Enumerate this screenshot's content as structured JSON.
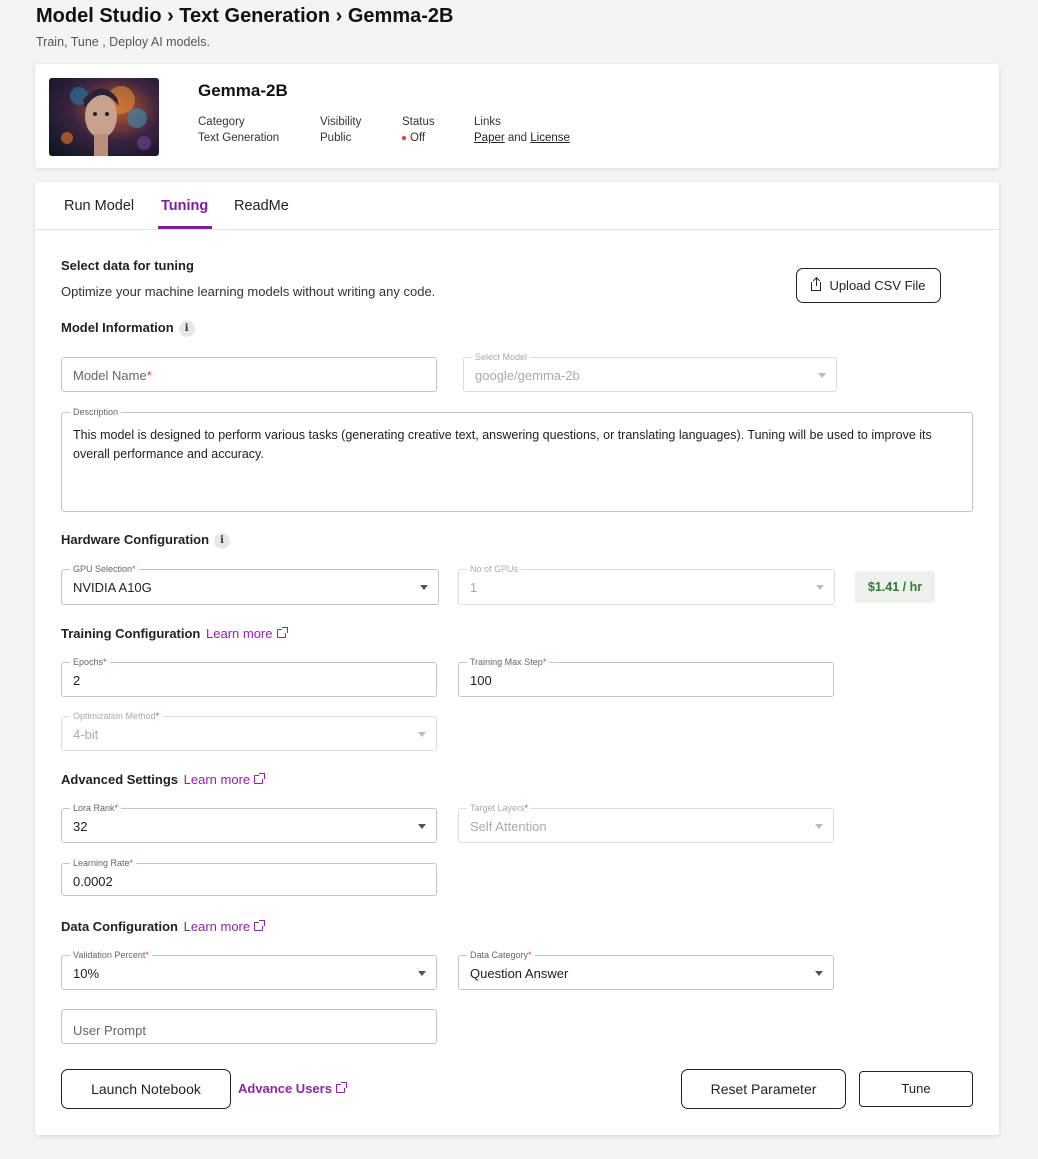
{
  "header": {
    "breadcrumb": "Model Studio › Text Generation › Gemma-2B",
    "subtitle": "Train, Tune , Deploy AI models."
  },
  "model": {
    "name": "Gemma-2B",
    "category_label": "Category",
    "category_value": "Text Generation",
    "visibility_label": "Visibility",
    "visibility_value": "Public",
    "status_label": "Status",
    "status_value": "Off",
    "links_label": "Links",
    "link_paper": "Paper",
    "link_and": " and ",
    "link_license": "License"
  },
  "tabs": [
    {
      "label": "Run Model",
      "active": false
    },
    {
      "label": "Tuning",
      "active": true
    },
    {
      "label": "ReadMe",
      "active": false
    }
  ],
  "data_section": {
    "title": "Select data for tuning",
    "text": "Optimize your machine learning models without writing any code.",
    "upload_label": "Upload CSV File"
  },
  "model_info": {
    "title": "Model Information",
    "model_name_placeholder": "Model Name",
    "select_model_label": "Select Model",
    "select_model_value": "google/gemma-2b",
    "description_label": "Description",
    "description_value": "This model is designed to perform various tasks (generating creative text, answering questions, or translating languages). Tuning will be used to improve its overall performance and accuracy."
  },
  "hardware": {
    "title": "Hardware Configuration",
    "gpu_label": "GPU Selection",
    "gpu_value": "NVIDIA A10G",
    "num_gpus_label": "No of GPUs",
    "num_gpus_value": "1",
    "price": "$1.41 / hr"
  },
  "training": {
    "title": "Training Configuration",
    "learn_more": "Learn more",
    "epochs_label": "Epochs",
    "epochs_value": "2",
    "max_step_label": "Training Max Step",
    "max_step_value": "100",
    "opt_label": "Optimization Method",
    "opt_value": "4-bit"
  },
  "advanced": {
    "title": "Advanced Settings",
    "learn_more": "Learn more",
    "lora_label": "Lora Rank",
    "lora_value": "32",
    "target_label": "Target Layers",
    "target_value": "Self Attention",
    "lr_label": "Learning Rate",
    "lr_value": "0.0002"
  },
  "data_config": {
    "title": "Data Configuration",
    "learn_more": "Learn more",
    "val_label": "Validation Percent",
    "val_value": "10%",
    "category_label": "Data Category",
    "category_value": "Question Answer",
    "user_prompt_placeholder": "User Prompt"
  },
  "footer": {
    "launch_label": "Launch Notebook",
    "advance_label": "Advance Users",
    "reset_label": "Reset Parameter",
    "tune_label": "Tune"
  },
  "colors": {
    "accent": "#7b1fa2",
    "link": "#8e24aa",
    "status_off": "#e53935",
    "price": "#2e7d32"
  }
}
